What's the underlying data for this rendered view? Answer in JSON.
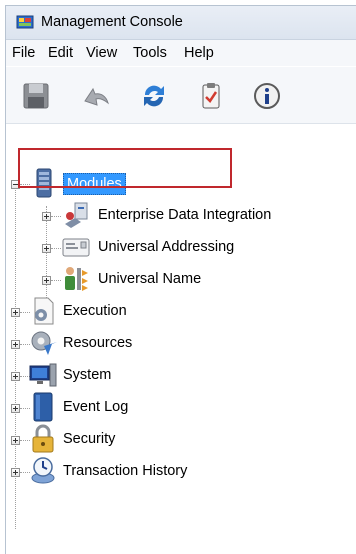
{
  "window": {
    "title": "Management Console"
  },
  "menu": [
    "File",
    "Edit",
    "View",
    "Tools",
    "Help"
  ],
  "toolbar": {
    "icons": [
      "save-icon",
      "undo-icon",
      "refresh-icon",
      "clipboard-icon",
      "info-icon"
    ]
  },
  "tree": {
    "root": {
      "label": "Modules",
      "expanded": true,
      "selected": true
    },
    "modules": [
      {
        "label": "Enterprise Data Integration",
        "icon": "data-integration-icon"
      },
      {
        "label": "Universal Addressing",
        "icon": "addressing-icon"
      },
      {
        "label": "Universal Name",
        "icon": "universal-name-icon"
      }
    ],
    "items": [
      {
        "label": "Execution",
        "icon": "execution-icon"
      },
      {
        "label": "Resources",
        "icon": "resources-icon"
      },
      {
        "label": "System",
        "icon": "system-icon"
      },
      {
        "label": "Event Log",
        "icon": "event-log-icon"
      },
      {
        "label": "Security",
        "icon": "security-icon"
      },
      {
        "label": "Transaction History",
        "icon": "transaction-history-icon"
      }
    ]
  },
  "colors": {
    "highlight": "#c0282d",
    "selection": "#3399ff"
  }
}
